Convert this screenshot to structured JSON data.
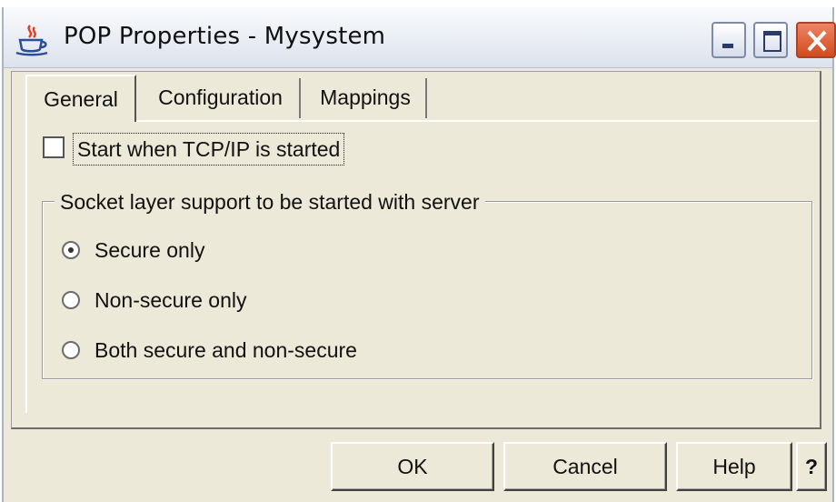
{
  "window": {
    "title": "POP Properties - Mysystem",
    "icon": "java-coffee-cup-icon"
  },
  "tabs": [
    {
      "label": "General",
      "selected": true
    },
    {
      "label": "Configuration",
      "selected": false
    },
    {
      "label": "Mappings",
      "selected": false
    }
  ],
  "general": {
    "start_checkbox": {
      "label": "Start when TCP/IP is started",
      "checked": false
    },
    "socket_group": {
      "title": "Socket layer support to be started with server",
      "options": [
        {
          "label": "Secure only",
          "selected": true
        },
        {
          "label": "Non-secure only",
          "selected": false
        },
        {
          "label": "Both secure and non-secure",
          "selected": false
        }
      ]
    }
  },
  "buttons": {
    "ok": "OK",
    "cancel": "Cancel",
    "help": "Help",
    "context_help": "?"
  }
}
